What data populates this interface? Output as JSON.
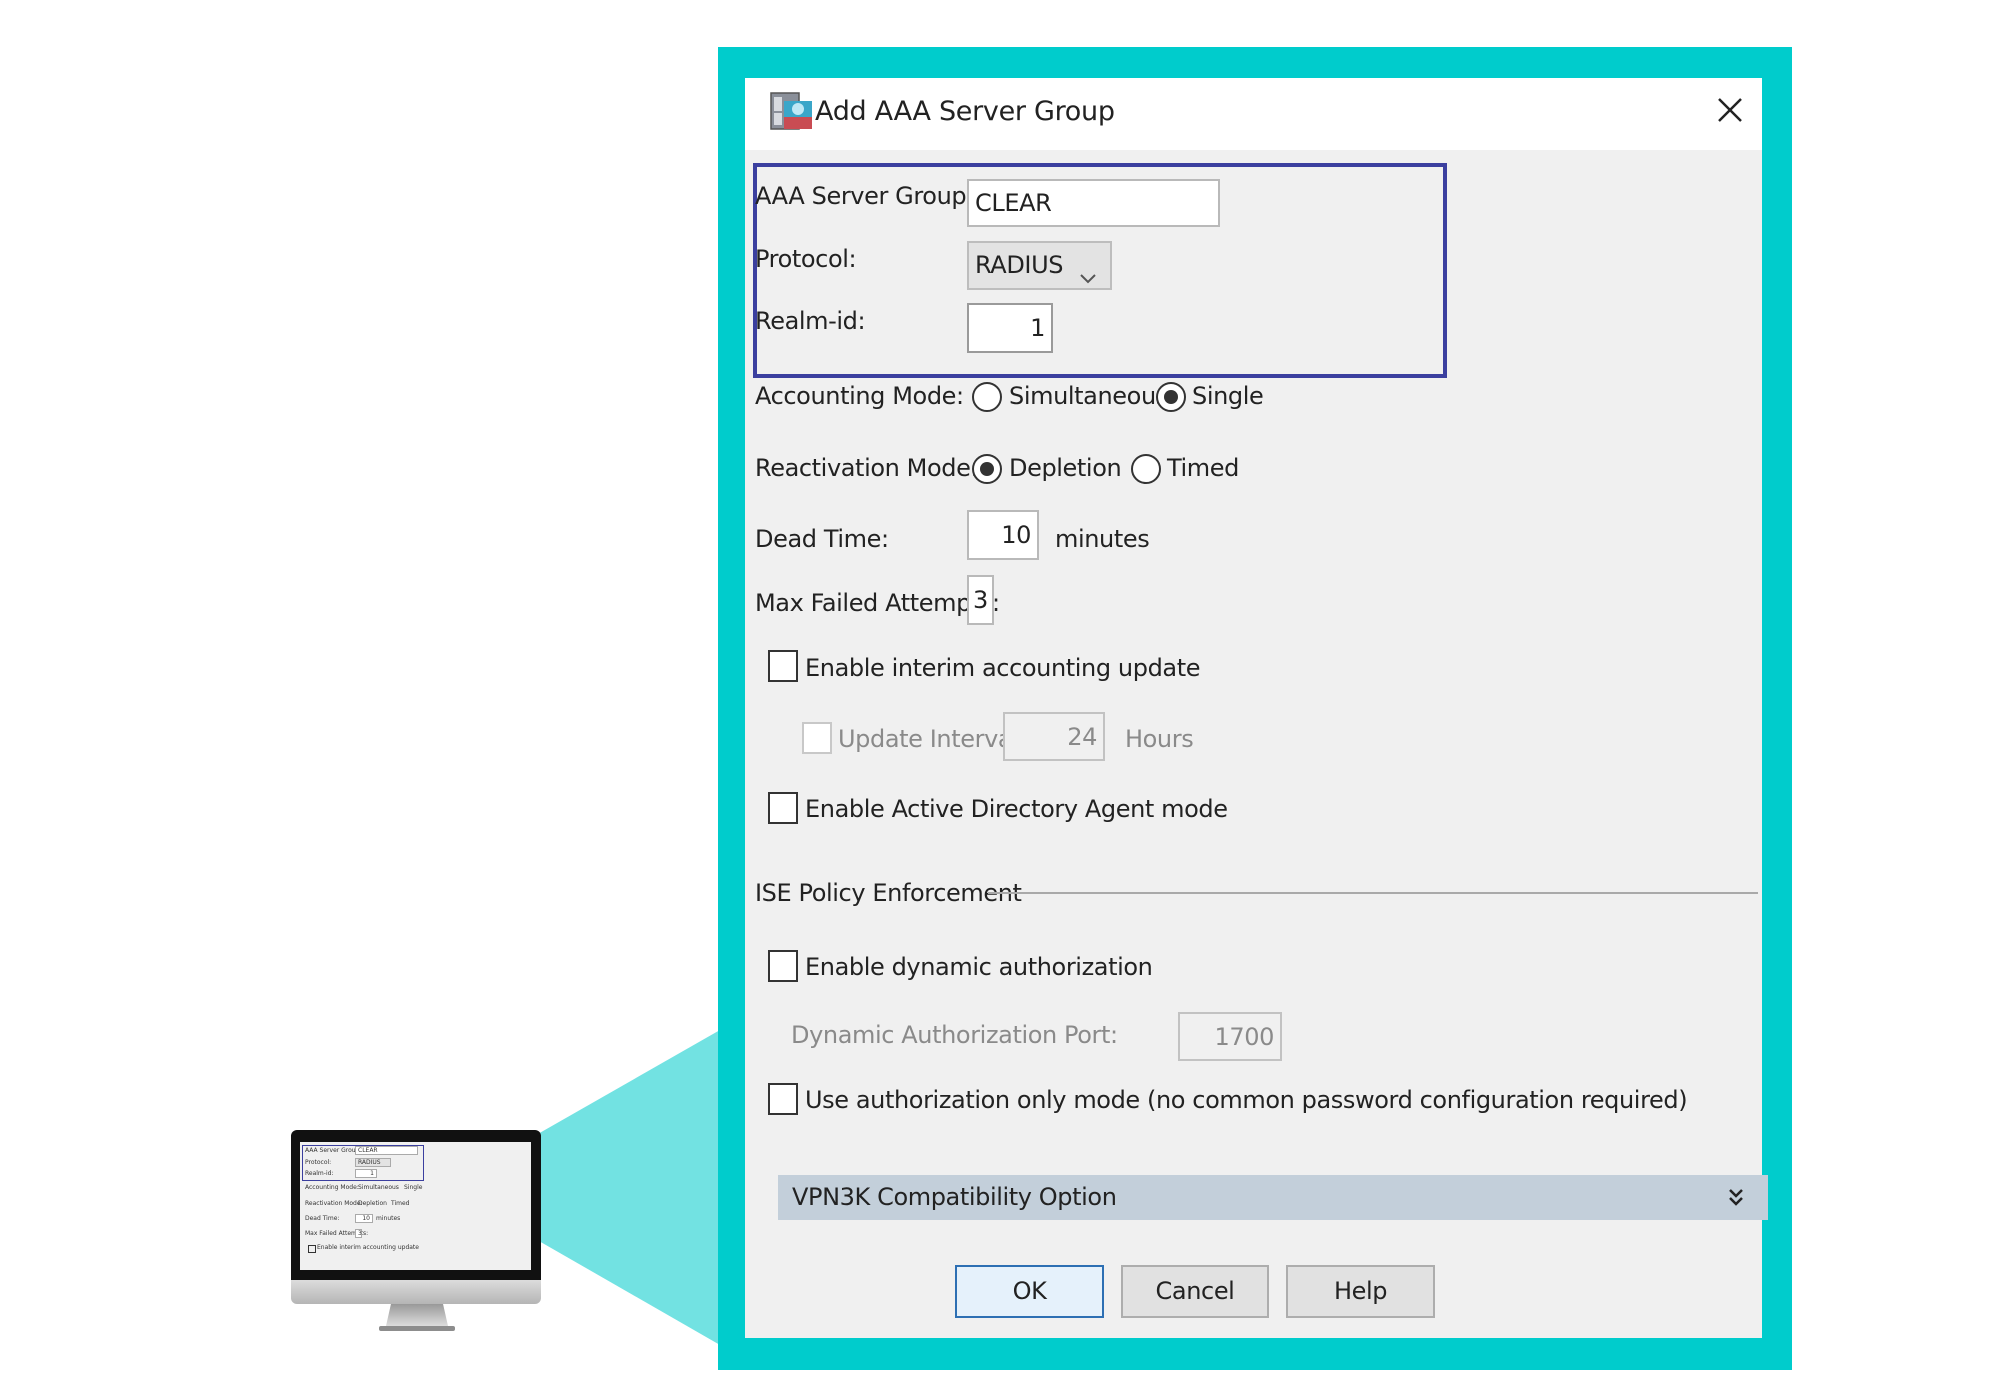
{
  "colors": {
    "frame": "#00cccc",
    "connector": "#72e2e2",
    "highlight": "#3b3f9f",
    "dialog_bg": "#f0f0f0",
    "vpn_bar": "#c3cfda",
    "default_button_border": "#2d6fb3"
  },
  "dialog": {
    "title": "Add AAA Server Group",
    "title_icon": "server-group-icon",
    "close_icon": "close-icon"
  },
  "form": {
    "server_group": {
      "label": "AAA Server Group:",
      "value": "CLEAR"
    },
    "protocol": {
      "label": "Protocol:",
      "value": "RADIUS",
      "icon": "chevron-down-icon"
    },
    "realm_id": {
      "label": "Realm-id:",
      "value": "1"
    },
    "accounting_mode": {
      "label": "Accounting Mode:",
      "options": [
        {
          "label": "Simultaneous",
          "selected": false
        },
        {
          "label": "Single",
          "selected": true
        }
      ]
    },
    "reactivation_mode": {
      "label": "Reactivation Mode:",
      "options": [
        {
          "label": "Depletion",
          "selected": true
        },
        {
          "label": "Timed",
          "selected": false
        }
      ]
    },
    "dead_time": {
      "label": "Dead Time:",
      "value": "10",
      "unit": "minutes"
    },
    "max_failed_attempts": {
      "label": "Max Failed Attempts:",
      "value": "3"
    },
    "interim_accounting": {
      "label": "Enable interim accounting update",
      "checked": false
    },
    "update_interval": {
      "label": "Update Interval:",
      "value": "24",
      "unit": "Hours",
      "checked": false,
      "disabled": true
    },
    "ad_agent_mode": {
      "label": "Enable Active Directory Agent mode",
      "checked": false
    }
  },
  "ise": {
    "heading": "ISE Policy Enforcement",
    "dynamic_authorization": {
      "label": "Enable dynamic authorization",
      "checked": false
    },
    "dynamic_port": {
      "label": "Dynamic Authorization Port:",
      "value": "1700",
      "disabled": true
    },
    "authorization_only": {
      "label": "Use authorization only mode (no common password configuration required)",
      "checked": false
    }
  },
  "vpn3k": {
    "label": "VPN3K Compatibility Option",
    "icon": "double-chevron-down-icon"
  },
  "buttons": {
    "ok": "OK",
    "cancel": "Cancel",
    "help": "Help"
  },
  "monitor_preview": {
    "server_group_label": "AAA Server Group:",
    "server_group_value": "CLEAR",
    "protocol_label": "Protocol:",
    "protocol_value": "RADIUS",
    "realm_label": "Realm-id:",
    "realm_value": "1",
    "accounting_label": "Accounting Mode:",
    "accounting_opt1": "Simultaneous",
    "accounting_opt2": "Single",
    "reactivation_label": "Reactivation Mode:",
    "reactivation_opt1": "Depletion",
    "reactivation_opt2": "Timed",
    "dead_time_label": "Dead Time:",
    "dead_time_value": "10",
    "dead_time_unit": "minutes",
    "max_failed_label": "Max Failed Attempts:",
    "max_failed_value": "3",
    "interim_label": "Enable interim accounting update"
  }
}
